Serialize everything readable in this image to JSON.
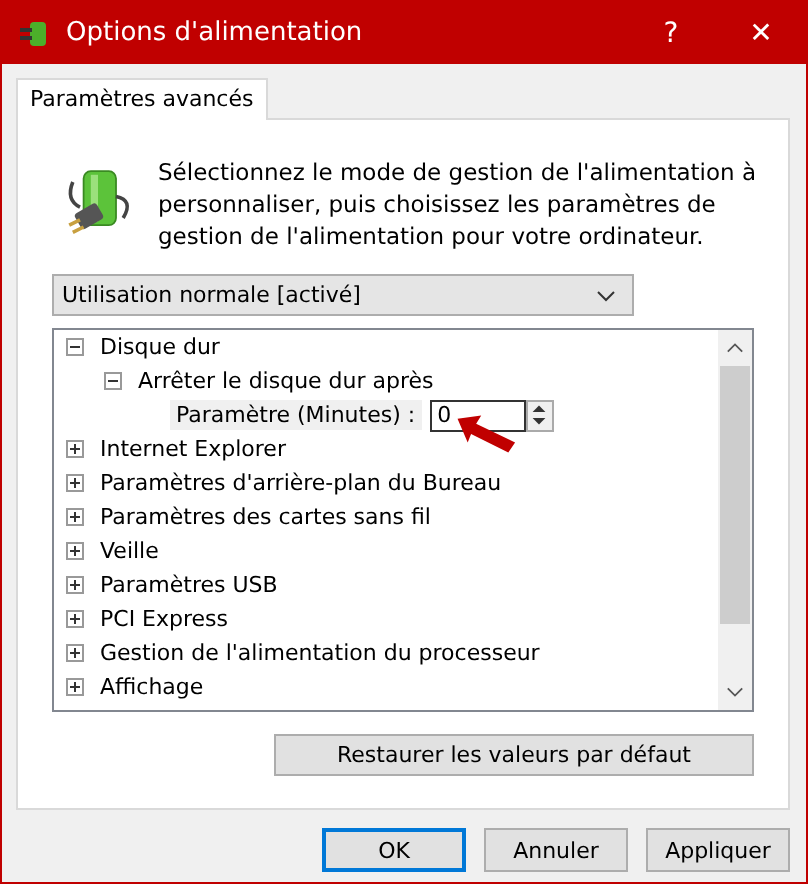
{
  "window": {
    "title": "Options d'alimentation",
    "help": "?",
    "close": "✕"
  },
  "tabs": [
    {
      "label": "Paramètres avancés",
      "selected": true
    }
  ],
  "intro": "Sélectionnez le mode de gestion de l'alimentation à personnaliser, puis choisissez les paramètres de gestion de l'alimentation pour votre ordinateur.",
  "plan_dropdown": {
    "value": "Utilisation normale [activé]"
  },
  "tree": [
    {
      "kind": "group",
      "label": "Disque dur",
      "expanded": true,
      "children": [
        {
          "kind": "group",
          "label": "Arrêter le disque dur après",
          "expanded": true,
          "children": [
            {
              "kind": "setting",
              "label": "Paramètre (Minutes) :",
              "value": "0"
            }
          ]
        }
      ]
    },
    {
      "kind": "group",
      "label": "Internet Explorer",
      "expanded": false
    },
    {
      "kind": "group",
      "label": "Paramètres d'arrière-plan du Bureau",
      "expanded": false
    },
    {
      "kind": "group",
      "label": "Paramètres des cartes sans fil",
      "expanded": false
    },
    {
      "kind": "group",
      "label": "Veille",
      "expanded": false
    },
    {
      "kind": "group",
      "label": "Paramètres USB",
      "expanded": false
    },
    {
      "kind": "group",
      "label": "PCI Express",
      "expanded": false
    },
    {
      "kind": "group",
      "label": "Gestion de l'alimentation du processeur",
      "expanded": false
    },
    {
      "kind": "group",
      "label": "Affichage",
      "expanded": false
    }
  ],
  "restore_button": "Restaurer les valeurs par défaut",
  "buttons": [
    {
      "label": "OK",
      "selected": true
    },
    {
      "label": "Annuler",
      "selected": false
    },
    {
      "label": "Appliquer",
      "selected": false
    }
  ]
}
